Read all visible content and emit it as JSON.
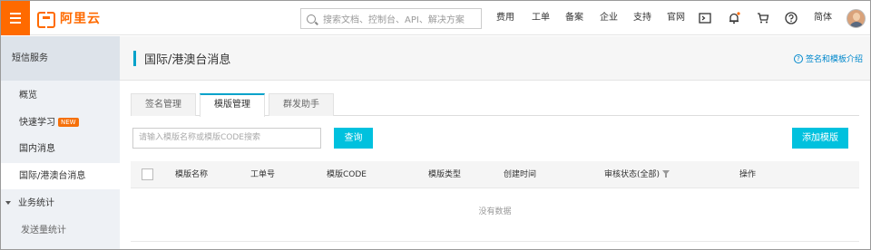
{
  "brand": {
    "name": "阿里云",
    "accent": "#ff6a00"
  },
  "search": {
    "placeholder": "搜索文档、控制台、API、解决方案"
  },
  "topnav": [
    "费用",
    "工单",
    "备案",
    "企业",
    "支持",
    "官网"
  ],
  "topicons": [
    "terminal-icon",
    "bell-icon",
    "cart-icon",
    "help-icon"
  ],
  "lang": "简体",
  "sidebar": {
    "title": "短信服务",
    "items": [
      {
        "label": "概览"
      },
      {
        "label": "快速学习",
        "badge": "NEW"
      },
      {
        "label": "国内消息"
      },
      {
        "label": "国际/港澳台消息"
      },
      {
        "label": "业务统计"
      },
      {
        "label": "发送量统计"
      }
    ]
  },
  "page": {
    "title": "国际/港澳台消息",
    "help": "签名和模板介绍"
  },
  "tabs": [
    {
      "label": "签名管理"
    },
    {
      "label": "模版管理"
    },
    {
      "label": "群发助手"
    }
  ],
  "toolbar": {
    "query_placeholder": "请输入模版名称或模版CODE搜索",
    "query_button": "查询",
    "add_button": "添加模版"
  },
  "table": {
    "columns": [
      "模版名称",
      "工单号",
      "模版CODE",
      "模版类型",
      "创建时间",
      "审核状态(全部)",
      "操作"
    ],
    "empty_text": "没有数据"
  }
}
